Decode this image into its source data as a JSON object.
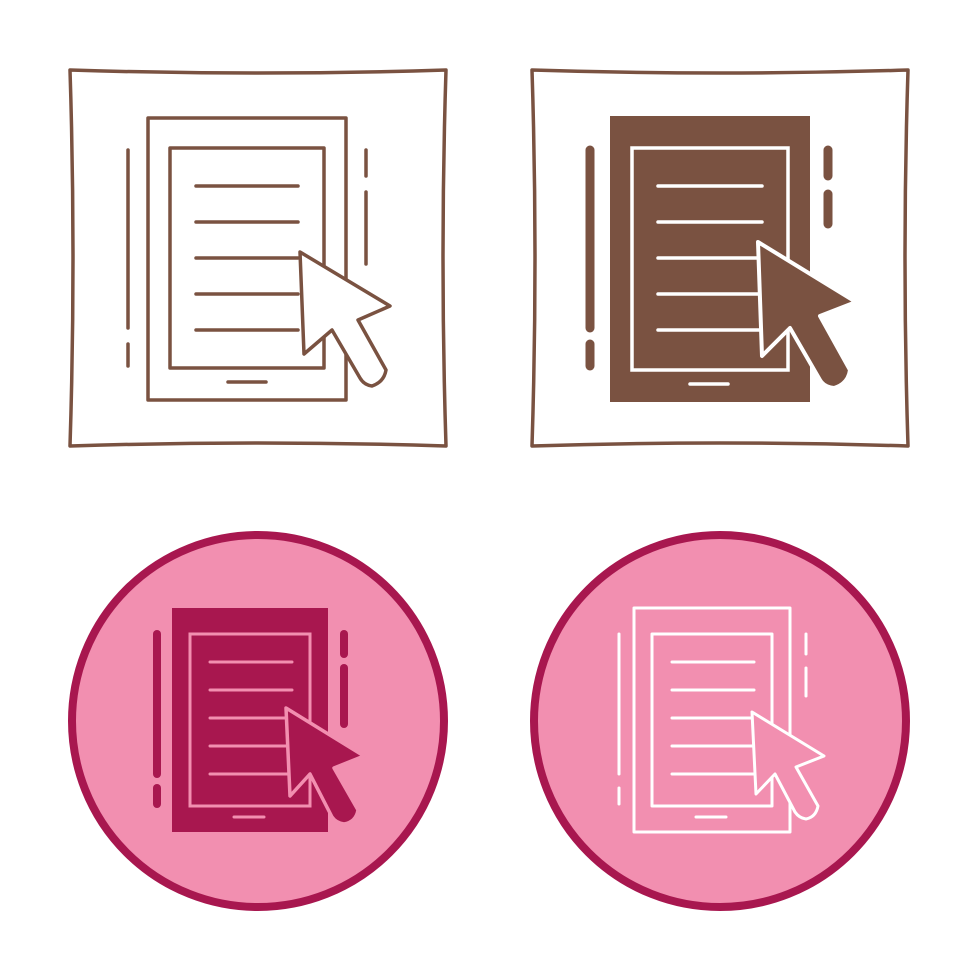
{
  "icons": [
    {
      "name": "tablet-document-cursor-outline-icon",
      "style": "outline",
      "colors": {
        "stroke": "#7a5241",
        "fill": "#ffffff"
      }
    },
    {
      "name": "tablet-document-cursor-filled-icon",
      "style": "filled",
      "colors": {
        "stroke": "#7a5241",
        "fill": "#7a5241",
        "inner": "#ffffff"
      }
    },
    {
      "name": "tablet-document-cursor-pink-filled-icon",
      "style": "pink-filled",
      "colors": {
        "circle": "#f28fb0",
        "ring": "#a8174f",
        "fill": "#a8174f",
        "inner": "#ffffff"
      }
    },
    {
      "name": "tablet-document-cursor-pink-outline-icon",
      "style": "pink-outline",
      "colors": {
        "circle": "#f28fb0",
        "ring": "#a8174f",
        "stroke": "#ffffff"
      }
    }
  ]
}
